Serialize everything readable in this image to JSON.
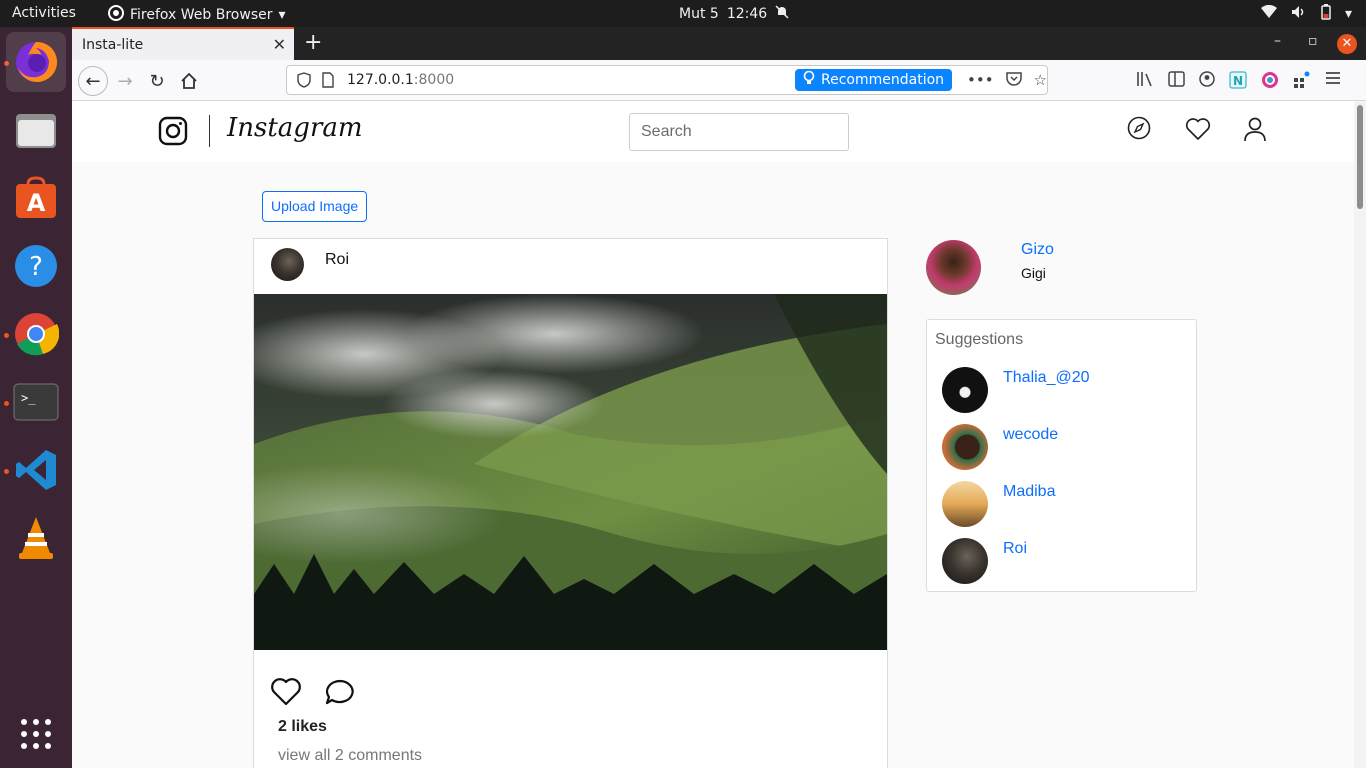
{
  "system_bar": {
    "activities": "Activities",
    "app_name": "Firefox Web Browser",
    "date": "Mut 5",
    "time": "12:46"
  },
  "dock": {
    "items": [
      "firefox-icon",
      "files-icon",
      "software-icon",
      "help-icon",
      "chrome-icon",
      "terminal-icon",
      "vscode-icon",
      "vlc-icon",
      "app-grid-icon"
    ]
  },
  "browser": {
    "tab_title": "Insta-lite",
    "url_host": "127.0.0.1",
    "url_port": ":8000",
    "recommendation": "Recommendation",
    "colors": {
      "accent": "#e95420",
      "reco": "#0a84ff"
    }
  },
  "app": {
    "wordmark": "Instagram",
    "search_placeholder": "Search",
    "upload_label": "Upload Image",
    "colors": {
      "link": "#0d6efd"
    }
  },
  "post": {
    "username": "Roi",
    "likes": "2 likes",
    "comments": "view all 2 comments"
  },
  "profile": {
    "username": "Gizo",
    "name": "Gigi"
  },
  "suggestions": {
    "title": "Suggestions",
    "users": [
      {
        "name": "Thalia_@20"
      },
      {
        "name": "wecode"
      },
      {
        "name": "Madiba"
      },
      {
        "name": "Roi"
      }
    ]
  }
}
